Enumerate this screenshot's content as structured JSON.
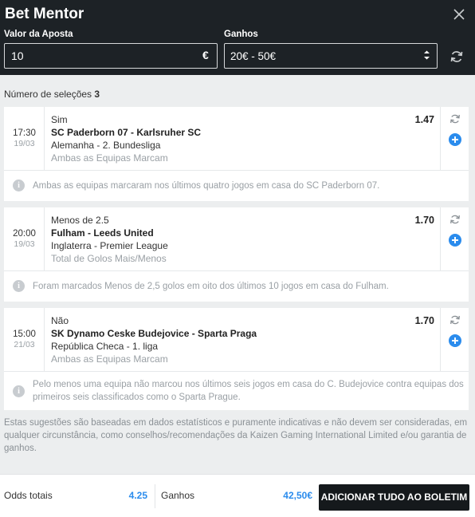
{
  "header": {
    "title": "Bet Mentor",
    "close_icon": "close-icon",
    "stake_label": "Valor da Aposta",
    "stake_value": "10",
    "currency": "€",
    "winnings_label": "Ganhos",
    "winnings_range": "20€ - 50€",
    "refresh_icon": "refresh-icon"
  },
  "selection_count": {
    "label": "Número de seleções",
    "value": "3"
  },
  "selections": [
    {
      "time": "17:30",
      "date": "19/03",
      "pick": "Sim",
      "match": "SC Paderborn 07 - Karlsruher SC",
      "league": "Alemanha - 2. Bundesliga",
      "market": "Ambas as Equipas Marcam",
      "odds": "1.47",
      "note": "Ambas as equipas marcaram nos últimos quatro jogos em casa do SC Paderborn 07."
    },
    {
      "time": "20:00",
      "date": "19/03",
      "pick": "Menos de 2.5",
      "match": "Fulham - Leeds United",
      "league": "Inglaterra - Premier League",
      "market": "Total de Golos Mais/Menos",
      "odds": "1.70",
      "note": "Foram marcados Menos de 2,5 golos em oito dos últimos 10 jogos em casa do Fulham."
    },
    {
      "time": "15:00",
      "date": "21/03",
      "pick": "Não",
      "match": "SK Dynamo Ceske Budejovice - Sparta Praga",
      "league": "República Checa - 1. liga",
      "market": "Ambas as Equipas Marcam",
      "odds": "1.70",
      "note": "Pelo menos uma equipa não marcou nos últimos seis jogos em casa do C. Budejovice contra equipas dos primeiros seis classificados como o Sparta Prague."
    }
  ],
  "disclaimer": "Estas sugestões são baseadas em dados estatísticos e puramente indicativas e não devem ser consideradas, em qualquer circunstância, como conselhos/recomendações da Kaizen Gaming International Limited e/ou garantia de ganhos.",
  "footer": {
    "odds_label": "Odds totais",
    "odds_value": "4.25",
    "winnings_label": "Ganhos",
    "winnings_value": "42,50€",
    "add_all_button": "ADICIONAR TUDO AO BOLETIM"
  },
  "colors": {
    "header_bg": "#1d2226",
    "page_bg": "#eceeef",
    "accent_blue": "#2b8ced",
    "button_bg": "#15191c"
  }
}
